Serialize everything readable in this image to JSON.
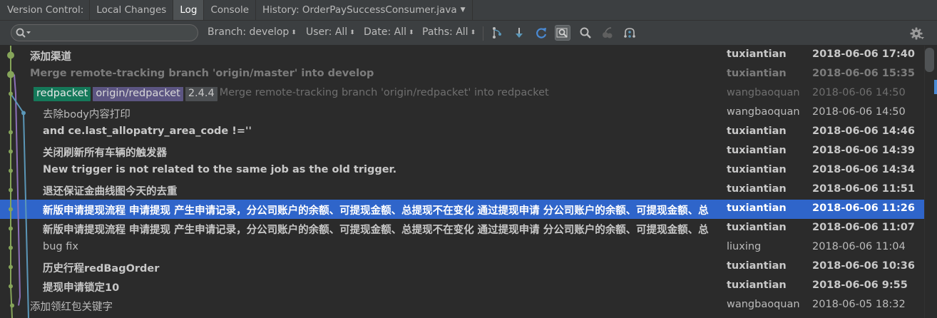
{
  "tabs": {
    "label": "Version Control:",
    "items": [
      "Local Changes",
      "Log",
      "Console"
    ],
    "history": "History: OrderPaySuccessConsumer.java",
    "active": "Log"
  },
  "toolbar": {
    "search_placeholder": "",
    "branch": "Branch: develop",
    "user": "User: All",
    "date": "Date: All",
    "paths": "Paths: All",
    "icons": [
      "collapse-linear-branches-icon",
      "show-long-edges-icon",
      "refresh-icon",
      "highlight-commits-icon",
      "find-icon",
      "cherry-pick-icon",
      "intellisort-icon",
      "settings-gear-icon"
    ]
  },
  "colors": {
    "background": "#2b2b2b",
    "toolbar": "#3c3f41",
    "selection": "#2f65ca",
    "graph_green": "#86a55a",
    "graph_blue": "#5b97b8",
    "graph_purple": "#8c6fb8",
    "tag_local": "#15795a",
    "tag_remote": "#5c5582",
    "tag_version": "#4c4f52"
  },
  "commits": [
    {
      "message": "添加渠道",
      "author": "tuxiantian",
      "date": "2018-06-06 17:40",
      "style": "bold",
      "tags": []
    },
    {
      "message": "Merge remote-tracking branch 'origin/master' into develop",
      "author": "tuxiantian",
      "date": "2018-06-06 15:35",
      "style": "dim-bold",
      "tags": []
    },
    {
      "message": "Merge remote-tracking branch 'origin/redpacket' into redpacket",
      "author": "wangbaoquan",
      "date": "2018-06-06 14:50",
      "style": "dim",
      "tags": [
        "redpacket",
        "origin/redpacket",
        "2.4.4"
      ]
    },
    {
      "message": "去除body内容打印",
      "author": "wangbaoquan",
      "date": "2018-06-06 14:50",
      "style": "normal",
      "tags": []
    },
    {
      "message": "and ce.last_allopatry_area_code !=''",
      "author": "tuxiantian",
      "date": "2018-06-06 14:46",
      "style": "bold",
      "tags": []
    },
    {
      "message": "关闭刷新所有车辆的触发器",
      "author": "tuxiantian",
      "date": "2018-06-06 14:39",
      "style": "bold",
      "tags": []
    },
    {
      "message": "New trigger is not related to the same job as the old trigger.",
      "author": "tuxiantian",
      "date": "2018-06-06 14:34",
      "style": "bold",
      "tags": []
    },
    {
      "message": "退还保证金曲线图今天的去重",
      "author": "tuxiantian",
      "date": "2018-06-06 11:51",
      "style": "bold",
      "tags": []
    },
    {
      "message": "新版申请提现流程 申请提现 产生申请记录，分公司账户的余额、可提现金额、总提现不在变化 通过提现申请 分公司账户的余额、可提现金额、总",
      "author": "tuxiantian",
      "date": "2018-06-06 11:26",
      "style": "selected",
      "tags": []
    },
    {
      "message": "新版申请提现流程 申请提现 产生申请记录，分公司账户的余额、可提现金额、总提现不在变化 通过提现申请 分公司账户的余额、可提现金额、总",
      "author": "tuxiantian",
      "date": "2018-06-06 11:07",
      "style": "bold",
      "tags": []
    },
    {
      "message": "bug fix",
      "author": "liuxing",
      "date": "2018-06-06 11:04",
      "style": "normal",
      "tags": []
    },
    {
      "message": "历史行程redBagOrder",
      "author": "tuxiantian",
      "date": "2018-06-06 10:36",
      "style": "bold",
      "tags": []
    },
    {
      "message": "提现申请锁定10",
      "author": "tuxiantian",
      "date": "2018-06-06 9:55",
      "style": "bold",
      "tags": []
    },
    {
      "message": "添加领红包关键字",
      "author": "wangbaoquan",
      "date": "2018-06-05 18:32",
      "style": "normal",
      "tags": []
    }
  ]
}
